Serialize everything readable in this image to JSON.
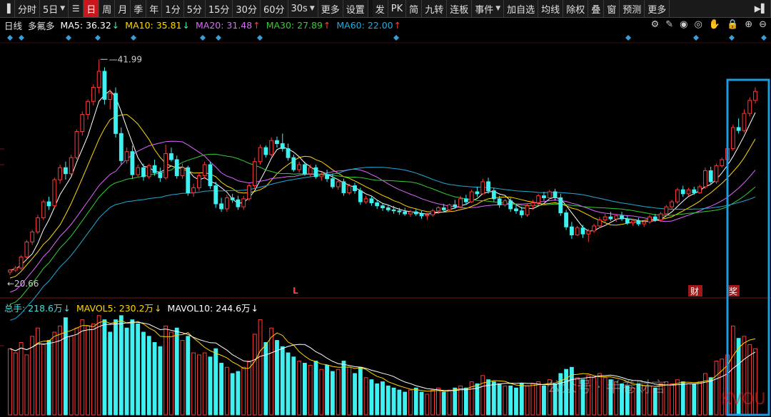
{
  "toolbar": {
    "items": [
      {
        "type": "icon",
        "icon": "sidebar-toggle-icon",
        "glyph": "▐"
      },
      {
        "type": "btn",
        "label": "分时"
      },
      {
        "type": "btn",
        "label": "5日",
        "caret": true
      },
      {
        "type": "icon",
        "icon": "list-icon",
        "glyph": "☰"
      },
      {
        "type": "btn",
        "label": "日",
        "active": true
      },
      {
        "type": "btn",
        "label": "周"
      },
      {
        "type": "btn",
        "label": "月"
      },
      {
        "type": "btn",
        "label": "季"
      },
      {
        "type": "btn",
        "label": "年"
      },
      {
        "type": "btn",
        "label": "1分"
      },
      {
        "type": "btn",
        "label": "5分"
      },
      {
        "type": "btn",
        "label": "15分"
      },
      {
        "type": "btn",
        "label": "30分"
      },
      {
        "type": "btn",
        "label": "60分"
      },
      {
        "type": "btn",
        "label": "30s",
        "caret": true
      },
      {
        "type": "btn",
        "label": "更多"
      },
      {
        "type": "btn",
        "label": "设置"
      },
      {
        "type": "sep"
      },
      {
        "type": "btn",
        "label": "发"
      },
      {
        "type": "btn",
        "label": "PK"
      },
      {
        "type": "btn",
        "label": "简"
      },
      {
        "type": "btn",
        "label": "九转"
      },
      {
        "type": "btn",
        "label": "连板"
      },
      {
        "type": "btn",
        "label": "事件",
        "caret": true
      },
      {
        "type": "btn",
        "label": "加自选"
      },
      {
        "type": "btn",
        "label": "均线"
      },
      {
        "type": "btn",
        "label": "除权"
      },
      {
        "type": "btn",
        "label": "叠"
      },
      {
        "type": "btn",
        "label": "窗"
      },
      {
        "type": "btn",
        "label": "预测"
      },
      {
        "type": "btn",
        "label": "更多"
      },
      {
        "type": "icon",
        "icon": "collapse-right-icon",
        "glyph": "▶▌"
      }
    ]
  },
  "header": {
    "period": "日线",
    "stock_name": "多氟多",
    "ma": [
      {
        "label": "MA5: 36.32",
        "arrow": "↓",
        "color": "#ffffff"
      },
      {
        "label": "MA10: 35.81",
        "arrow": "↓",
        "color": "#ffd700"
      },
      {
        "label": "MA20: 31.48",
        "arrow": "↑",
        "color": "#e066ff"
      },
      {
        "label": "MA30: 27.89",
        "arrow": "↑",
        "color": "#33cc33"
      },
      {
        "label": "MA60: 22.00",
        "arrow": "↑",
        "color": "#22aadd"
      }
    ]
  },
  "vol_header": {
    "items": [
      {
        "label": "总手: 218.6万",
        "arrow": "↓",
        "color": "#40e0e0"
      },
      {
        "label": "MAVOL5: 230.2万",
        "arrow": "↓",
        "color": "#ffd700"
      },
      {
        "label": "MAVOL10: 244.6万",
        "arrow": "↓",
        "color": "#ffffff"
      }
    ]
  },
  "tools": [
    "settings-icon",
    "pen-icon",
    "eye-icon",
    "visibility-icon",
    "hand-icon",
    "lock-icon",
    "zoom-in-icon",
    "zoom-out-icon"
  ],
  "tool_glyphs": [
    "⚙",
    "✎",
    "◉",
    "◎",
    "✋",
    "🔒",
    "⊕",
    "⊖"
  ],
  "colors": {
    "up": "#ff3a3a",
    "down": "#3ef0f0",
    "highlight_box": "#1e9be0",
    "diamond": "#3a9fd8"
  },
  "markers": {
    "L": "L",
    "cai": "财",
    "jiang": "奖"
  },
  "watermark": {
    "text": "公众号 · 半卷财言",
    "stamp": "KVOU"
  },
  "chart_data": {
    "type": "candlestick",
    "max_label": "41.99",
    "min_label": "20.66",
    "ylim": [
      19.5,
      43.5
    ],
    "candles": [
      [
        20.8,
        21.1,
        20.5,
        21.0
      ],
      [
        21.0,
        21.4,
        20.8,
        21.2
      ],
      [
        21.2,
        22.5,
        21.0,
        22.3
      ],
      [
        22.3,
        24.0,
        22.0,
        23.8
      ],
      [
        23.8,
        25.0,
        23.5,
        24.8
      ],
      [
        24.8,
        26.5,
        24.6,
        26.2
      ],
      [
        26.2,
        28.0,
        26.0,
        27.8
      ],
      [
        27.8,
        28.3,
        27.0,
        27.4
      ],
      [
        27.4,
        30.2,
        27.2,
        30.0
      ],
      [
        30.0,
        31.5,
        29.6,
        31.2
      ],
      [
        31.2,
        31.8,
        30.0,
        30.6
      ],
      [
        30.6,
        32.5,
        30.4,
        32.2
      ],
      [
        32.2,
        35.0,
        32.0,
        34.8
      ],
      [
        34.8,
        36.8,
        34.4,
        36.5
      ],
      [
        36.5,
        38.0,
        36.0,
        37.8
      ],
      [
        37.8,
        39.5,
        37.4,
        39.2
      ],
      [
        39.2,
        41.99,
        38.6,
        40.8
      ],
      [
        40.8,
        41.2,
        37.5,
        38.0
      ],
      [
        38.0,
        39.0,
        37.0,
        38.6
      ],
      [
        38.6,
        39.2,
        34.2,
        34.6
      ],
      [
        34.6,
        35.2,
        31.5,
        31.9
      ],
      [
        31.9,
        33.2,
        31.6,
        32.8
      ],
      [
        32.8,
        33.4,
        30.1,
        30.5
      ],
      [
        30.5,
        31.5,
        30.2,
        31.2
      ],
      [
        31.2,
        31.6,
        29.9,
        30.3
      ],
      [
        30.3,
        31.6,
        30.1,
        31.4
      ],
      [
        31.4,
        32.0,
        30.4,
        30.7
      ],
      [
        30.7,
        31.2,
        29.8,
        30.2
      ],
      [
        30.2,
        33.5,
        30.0,
        32.6
      ],
      [
        32.6,
        33.2,
        31.8,
        32.0
      ],
      [
        32.0,
        32.4,
        30.1,
        30.4
      ],
      [
        30.4,
        31.6,
        30.1,
        31.2
      ],
      [
        31.2,
        31.4,
        28.4,
        28.7
      ],
      [
        28.7,
        29.6,
        28.3,
        29.2
      ],
      [
        29.2,
        30.7,
        28.9,
        30.4
      ],
      [
        30.4,
        31.8,
        30.1,
        31.5
      ],
      [
        31.5,
        31.8,
        29.1,
        29.4
      ],
      [
        29.4,
        29.8,
        27.2,
        27.6
      ],
      [
        27.6,
        28.2,
        26.8,
        27.1
      ],
      [
        27.1,
        28.5,
        26.8,
        28.2
      ],
      [
        28.2,
        28.6,
        27.7,
        28.0
      ],
      [
        28.0,
        28.4,
        27.0,
        27.3
      ],
      [
        27.3,
        28.4,
        27.0,
        28.1
      ],
      [
        28.1,
        29.6,
        27.9,
        29.4
      ],
      [
        29.4,
        32.2,
        29.1,
        31.8
      ],
      [
        31.8,
        33.5,
        31.5,
        33.2
      ],
      [
        33.2,
        33.4,
        32.2,
        32.5
      ],
      [
        32.5,
        34.2,
        32.3,
        33.9
      ],
      [
        33.9,
        34.3,
        33.2,
        33.6
      ],
      [
        33.6,
        34.6,
        32.8,
        33.1
      ],
      [
        33.1,
        33.6,
        31.9,
        32.2
      ],
      [
        32.2,
        32.5,
        30.8,
        31.0
      ],
      [
        31.0,
        31.8,
        30.7,
        31.5
      ],
      [
        31.5,
        31.8,
        30.4,
        30.6
      ],
      [
        30.6,
        31.5,
        30.3,
        31.2
      ],
      [
        31.2,
        31.5,
        30.1,
        30.3
      ],
      [
        30.3,
        30.8,
        29.9,
        30.5
      ],
      [
        30.5,
        31.0,
        29.8,
        30.1
      ],
      [
        30.1,
        30.6,
        29.1,
        29.3
      ],
      [
        29.3,
        30.1,
        29.0,
        29.8
      ],
      [
        29.8,
        30.1,
        28.4,
        28.7
      ],
      [
        28.7,
        29.6,
        28.5,
        29.4
      ],
      [
        29.4,
        29.7,
        28.6,
        28.9
      ],
      [
        28.9,
        29.2,
        27.5,
        27.8
      ],
      [
        27.8,
        28.4,
        27.6,
        28.1
      ],
      [
        28.1,
        28.4,
        27.4,
        27.7
      ],
      [
        27.7,
        28.0,
        27.1,
        27.4
      ],
      [
        27.4,
        27.7,
        26.9,
        27.2
      ],
      [
        27.2,
        27.5,
        26.8,
        27.0
      ],
      [
        27.0,
        27.4,
        26.6,
        26.9
      ],
      [
        26.9,
        27.2,
        26.5,
        26.8
      ],
      [
        26.8,
        27.2,
        26.4,
        26.6
      ],
      [
        26.6,
        27.0,
        26.3,
        26.8
      ],
      [
        26.8,
        27.1,
        26.4,
        26.6
      ],
      [
        26.6,
        26.9,
        26.1,
        26.4
      ],
      [
        26.4,
        26.7,
        26.0,
        26.5
      ],
      [
        26.5,
        27.1,
        26.3,
        26.9
      ],
      [
        26.9,
        27.4,
        26.6,
        27.2
      ],
      [
        27.2,
        27.6,
        26.8,
        27.0
      ],
      [
        27.0,
        27.6,
        26.9,
        27.5
      ],
      [
        27.5,
        28.0,
        27.1,
        27.3
      ],
      [
        27.3,
        28.4,
        27.2,
        28.1
      ],
      [
        28.1,
        28.5,
        27.5,
        27.8
      ],
      [
        27.8,
        29.0,
        27.7,
        28.8
      ],
      [
        28.8,
        29.3,
        28.3,
        28.6
      ],
      [
        28.6,
        30.1,
        28.5,
        29.8
      ],
      [
        29.8,
        30.2,
        28.6,
        28.9
      ],
      [
        28.9,
        29.2,
        27.8,
        28.1
      ],
      [
        28.1,
        28.4,
        27.2,
        27.5
      ],
      [
        27.5,
        28.1,
        27.3,
        27.9
      ],
      [
        27.9,
        28.2,
        26.8,
        27.1
      ],
      [
        27.1,
        27.5,
        26.6,
        26.9
      ],
      [
        26.9,
        27.3,
        26.2,
        26.5
      ],
      [
        26.5,
        27.6,
        26.3,
        27.4
      ],
      [
        27.4,
        28.0,
        27.0,
        27.7
      ],
      [
        27.7,
        28.6,
        27.5,
        28.4
      ],
      [
        28.4,
        28.8,
        27.9,
        28.2
      ],
      [
        28.2,
        29.0,
        28.0,
        28.8
      ],
      [
        28.8,
        29.1,
        27.9,
        28.2
      ],
      [
        28.2,
        28.6,
        26.4,
        26.7
      ],
      [
        26.7,
        27.0,
        25.0,
        25.3
      ],
      [
        25.3,
        25.8,
        24.1,
        24.5
      ],
      [
        24.5,
        25.4,
        24.4,
        25.2
      ],
      [
        25.2,
        25.5,
        24.2,
        24.6
      ],
      [
        24.6,
        25.1,
        23.8,
        24.9
      ],
      [
        24.9,
        25.6,
        24.7,
        25.4
      ],
      [
        25.4,
        26.3,
        25.2,
        26.0
      ],
      [
        26.0,
        26.6,
        25.7,
        26.3
      ],
      [
        26.3,
        26.8,
        25.9,
        26.1
      ],
      [
        26.1,
        26.6,
        25.8,
        26.4
      ],
      [
        26.4,
        26.8,
        25.9,
        26.1
      ],
      [
        26.1,
        26.4,
        25.5,
        25.7
      ],
      [
        25.7,
        26.1,
        25.4,
        25.9
      ],
      [
        25.9,
        26.2,
        25.4,
        25.6
      ],
      [
        25.6,
        26.0,
        25.3,
        25.8
      ],
      [
        25.8,
        26.5,
        25.6,
        26.3
      ],
      [
        26.3,
        26.6,
        25.8,
        26.0
      ],
      [
        26.0,
        26.8,
        25.8,
        26.6
      ],
      [
        26.6,
        27.5,
        26.4,
        27.3
      ],
      [
        27.3,
        28.0,
        27.1,
        27.8
      ],
      [
        27.8,
        29.2,
        27.6,
        29.0
      ],
      [
        29.0,
        29.4,
        28.3,
        28.6
      ],
      [
        28.6,
        29.2,
        28.4,
        29.0
      ],
      [
        29.0,
        29.3,
        28.5,
        28.7
      ],
      [
        28.7,
        29.5,
        28.6,
        29.3
      ],
      [
        29.3,
        31.2,
        29.1,
        30.9
      ],
      [
        30.9,
        31.3,
        29.5,
        29.8
      ],
      [
        29.8,
        31.6,
        29.6,
        31.4
      ],
      [
        31.4,
        32.2,
        31.2,
        32.0
      ],
      [
        32.0,
        33.4,
        31.8,
        33.1
      ],
      [
        33.1,
        35.5,
        32.9,
        35.2
      ],
      [
        35.2,
        36.1,
        34.6,
        34.9
      ],
      [
        34.9,
        37.0,
        34.7,
        36.6
      ],
      [
        36.6,
        38.2,
        36.3,
        37.9
      ],
      [
        37.9,
        39.2,
        37.6,
        38.8
      ]
    ],
    "volume": [
      [
        320,
        1
      ],
      [
        300,
        1
      ],
      [
        350,
        1
      ],
      [
        290,
        1
      ],
      [
        380,
        1
      ],
      [
        420,
        1
      ],
      [
        340,
        1
      ],
      [
        360,
        0
      ],
      [
        400,
        1
      ],
      [
        430,
        1
      ],
      [
        470,
        0
      ],
      [
        380,
        1
      ],
      [
        420,
        1
      ],
      [
        460,
        1
      ],
      [
        430,
        1
      ],
      [
        440,
        1
      ],
      [
        480,
        1
      ],
      [
        460,
        0
      ],
      [
        400,
        0
      ],
      [
        460,
        0
      ],
      [
        480,
        0
      ],
      [
        420,
        0
      ],
      [
        460,
        0
      ],
      [
        440,
        0
      ],
      [
        400,
        0
      ],
      [
        380,
        0
      ],
      [
        350,
        0
      ],
      [
        330,
        0
      ],
      [
        430,
        1
      ],
      [
        400,
        1
      ],
      [
        420,
        0
      ],
      [
        360,
        1
      ],
      [
        380,
        0
      ],
      [
        300,
        1
      ],
      [
        290,
        1
      ],
      [
        300,
        1
      ],
      [
        280,
        0
      ],
      [
        320,
        0
      ],
      [
        250,
        0
      ],
      [
        230,
        1
      ],
      [
        200,
        0
      ],
      [
        210,
        0
      ],
      [
        230,
        1
      ],
      [
        260,
        1
      ],
      [
        390,
        1
      ],
      [
        460,
        1
      ],
      [
        350,
        0
      ],
      [
        420,
        1
      ],
      [
        360,
        0
      ],
      [
        330,
        0
      ],
      [
        300,
        0
      ],
      [
        280,
        0
      ],
      [
        260,
        1
      ],
      [
        250,
        0
      ],
      [
        240,
        1
      ],
      [
        260,
        0
      ],
      [
        220,
        1
      ],
      [
        240,
        0
      ],
      [
        210,
        0
      ],
      [
        220,
        1
      ],
      [
        260,
        0
      ],
      [
        230,
        1
      ],
      [
        200,
        0
      ],
      [
        230,
        0
      ],
      [
        180,
        1
      ],
      [
        170,
        0
      ],
      [
        150,
        0
      ],
      [
        160,
        0
      ],
      [
        140,
        0
      ],
      [
        130,
        0
      ],
      [
        120,
        0
      ],
      [
        110,
        0
      ],
      [
        120,
        1
      ],
      [
        130,
        0
      ],
      [
        110,
        0
      ],
      [
        100,
        1
      ],
      [
        120,
        1
      ],
      [
        130,
        1
      ],
      [
        110,
        0
      ],
      [
        120,
        1
      ],
      [
        130,
        0
      ],
      [
        140,
        1
      ],
      [
        130,
        0
      ],
      [
        160,
        1
      ],
      [
        150,
        0
      ],
      [
        190,
        1
      ],
      [
        170,
        0
      ],
      [
        160,
        0
      ],
      [
        150,
        0
      ],
      [
        140,
        1
      ],
      [
        140,
        0
      ],
      [
        130,
        0
      ],
      [
        150,
        0
      ],
      [
        140,
        1
      ],
      [
        150,
        1
      ],
      [
        160,
        1
      ],
      [
        140,
        0
      ],
      [
        170,
        1
      ],
      [
        150,
        0
      ],
      [
        200,
        0
      ],
      [
        220,
        0
      ],
      [
        230,
        0
      ],
      [
        180,
        1
      ],
      [
        170,
        0
      ],
      [
        190,
        1
      ],
      [
        180,
        1
      ],
      [
        200,
        1
      ],
      [
        180,
        1
      ],
      [
        170,
        0
      ],
      [
        160,
        1
      ],
      [
        150,
        0
      ],
      [
        140,
        0
      ],
      [
        130,
        1
      ],
      [
        150,
        0
      ],
      [
        140,
        1
      ],
      [
        140,
        1
      ],
      [
        130,
        0
      ],
      [
        150,
        1
      ],
      [
        160,
        1
      ],
      [
        150,
        1
      ],
      [
        170,
        1
      ],
      [
        160,
        0
      ],
      [
        150,
        1
      ],
      [
        150,
        0
      ],
      [
        160,
        1
      ],
      [
        200,
        1
      ],
      [
        180,
        0
      ],
      [
        260,
        1
      ],
      [
        270,
        1
      ],
      [
        290,
        1
      ],
      [
        430,
        1
      ],
      [
        370,
        0
      ],
      [
        380,
        1
      ],
      [
        340,
        1
      ],
      [
        320,
        1
      ]
    ]
  }
}
